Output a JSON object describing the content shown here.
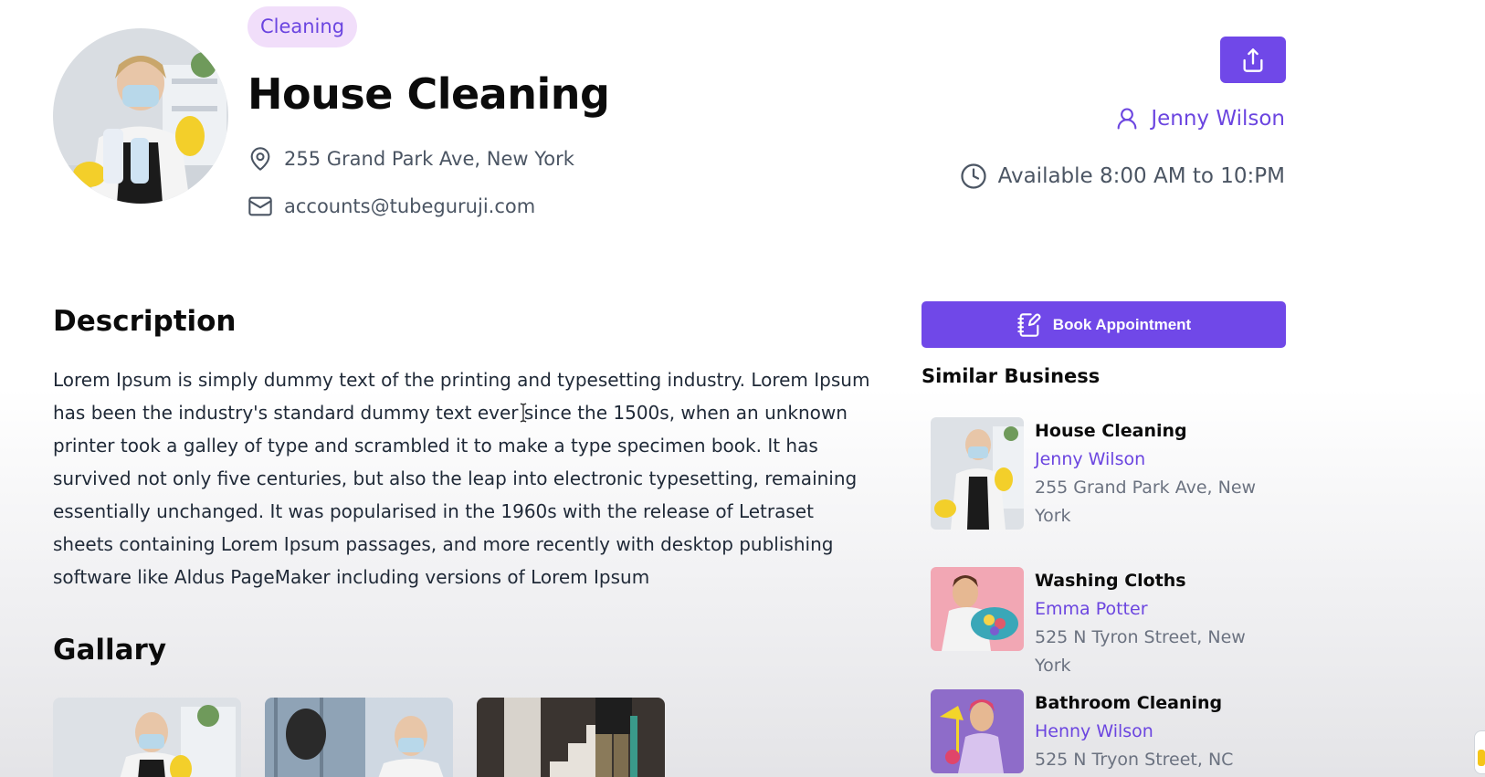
{
  "header": {
    "category_tag": "Cleaning",
    "title": "House Cleaning",
    "address": "255 Grand Park Ave, New York",
    "email": "accounts@tubeguruji.com",
    "owner": "Jenny Wilson",
    "availability": "Available 8:00 AM to 10:PM"
  },
  "icons": {
    "share": "share-icon",
    "location": "map-pin-icon",
    "email": "mail-icon",
    "user": "user-icon",
    "clock": "clock-icon",
    "book": "notebook-pen-icon"
  },
  "description": {
    "title": "Description",
    "text": "Lorem Ipsum is simply dummy text of the printing and typesetting industry. Lorem Ipsum has been the industry's standard dummy text ever since the 1500s, when an unknown printer took a galley of type and scrambled it to make a type specimen book. It has survived not only five centuries, but also the leap into electronic typesetting, remaining essentially unchanged. It was popularised in the 1960s with the release of Letraset sheets containing Lorem Ipsum passages, and more recently with desktop publishing software like Aldus PageMaker including versions of Lorem Ipsum"
  },
  "gallery": {
    "title": "Gallary"
  },
  "sidebar": {
    "book_label": "Book Appointment",
    "similar_title": "Similar Business",
    "items": [
      {
        "name": "House Cleaning",
        "owner": "Jenny Wilson",
        "address": "255 Grand Park Ave, New York"
      },
      {
        "name": "Washing Cloths",
        "owner": "Emma Potter",
        "address": "525 N Tyron Street, New York"
      },
      {
        "name": "Bathroom Cleaning",
        "owner": "Henny Wilson",
        "address": "525 N Tryon Street, NC"
      }
    ]
  },
  "colors": {
    "accent": "#7048e8",
    "tag_bg": "#f1defa",
    "text_muted": "#4b5563"
  }
}
